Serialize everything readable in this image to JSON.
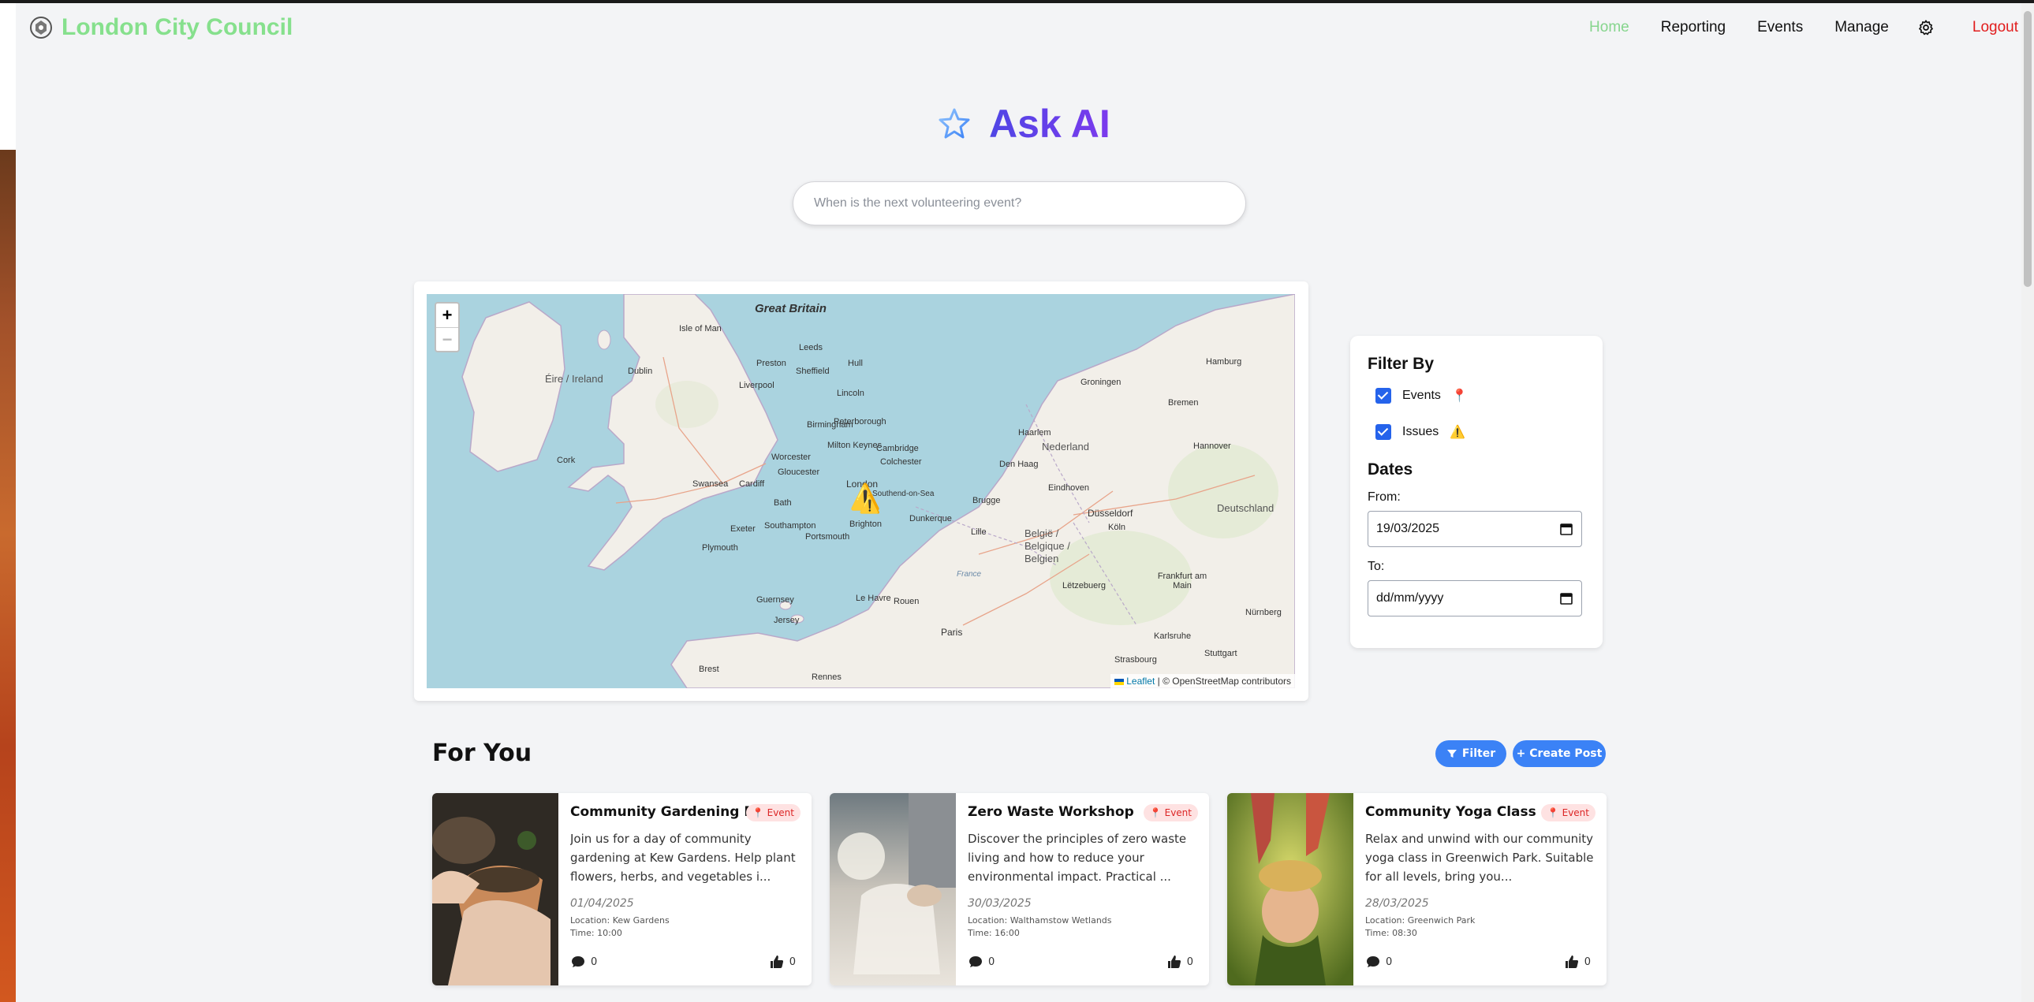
{
  "header": {
    "brand": "London City Council",
    "nav": {
      "home": "Home",
      "reporting": "Reporting",
      "events": "Events",
      "manage": "Manage",
      "logout": "Logout"
    }
  },
  "askai": {
    "title": "Ask AI",
    "placeholder": "When is the next volunteering event?"
  },
  "map": {
    "labels": {
      "great_britain": "Great Britain",
      "ireland": "Éire / Ireland",
      "dublin": "Dublin",
      "cork": "Cork",
      "isle_of_man": "Isle of Man",
      "leeds": "Leeds",
      "sheffield": "Sheffield",
      "hull": "Hull",
      "liverpool": "Liverpool",
      "preston": "Preston",
      "lincoln": "Lincoln",
      "birmingham": "Birmingham",
      "peterborough": "Peterborough",
      "cambridge": "Cambridge",
      "milton_keynes": "Milton Keynes",
      "colchester": "Colchester",
      "worcester": "Worcester",
      "gloucester": "Gloucester",
      "london": "London",
      "swansea": "Swansea",
      "cardiff": "Cardiff",
      "bath": "Bath",
      "southend": "Southend-on-Sea",
      "brighton": "Brighton",
      "southampton": "Southampton",
      "portsmouth": "Portsmouth",
      "exeter": "Exeter",
      "plymouth": "Plymouth",
      "dunkerque": "Dunkerque",
      "lille": "Lille",
      "brugge": "Brugge",
      "belgie": "België / Belgique / Belgien",
      "nederland": "Nederland",
      "den_haag": "Den Haag",
      "haarlem": "Haarlem",
      "eindhoven": "Eindhoven",
      "groningen": "Groningen",
      "bremen": "Bremen",
      "hamburg": "Hamburg",
      "hannover": "Hannover",
      "deutschland": "Deutschland",
      "dusseldorf": "Düsseldorf",
      "koln": "Köln",
      "frankfurt": "Frankfurt am Main",
      "nurnberg": "Nürnberg",
      "letzebuerg": "Lëtzebuerg",
      "paris": "Paris",
      "rouen": "Rouen",
      "le_havre": "Le Havre",
      "rennes": "Rennes",
      "brest": "Brest",
      "guernsey": "Guernsey",
      "jersey": "Jersey",
      "france": "France",
      "karlsruhe": "Karlsruhe",
      "stuttgart": "Stuttgart",
      "strasbourg": "Strasbourg"
    },
    "attribution_leaflet": "Leaflet",
    "attribution_osm": "| © OpenStreetMap contributors"
  },
  "filter": {
    "title": "Filter By",
    "events_label": "Events",
    "issues_label": "Issues",
    "events_checked": true,
    "issues_checked": true,
    "dates_title": "Dates",
    "from_label": "From:",
    "from_value": "19/03/2025",
    "to_label": "To:",
    "to_value": "dd/mm/yyyy"
  },
  "foryou": {
    "title": "For You",
    "filter_button": "Filter",
    "create_button": "+ Create Post",
    "cards": [
      {
        "title": "Community Gardening Day",
        "badge": "Event",
        "desc": "Join us for a day of community gardening at Kew Gardens. Help plant flowers, herbs, and vegetables i...",
        "date": "01/04/2025",
        "location": "Location: Kew Gardens",
        "time": "Time: 10:00",
        "comments": "0",
        "likes": "0"
      },
      {
        "title": "Zero Waste Workshop",
        "badge": "Event",
        "desc": "Discover the principles of zero waste living and how to reduce your environmental impact. Practical ...",
        "date": "30/03/2025",
        "location": "Location: Walthamstow Wetlands",
        "time": "Time: 16:00",
        "comments": "0",
        "likes": "0"
      },
      {
        "title": "Community Yoga Class",
        "badge": "Event",
        "desc": "Relax and unwind with our community yoga class in Greenwich Park. Suitable for all levels, bring you...",
        "date": "28/03/2025",
        "location": "Location: Greenwich Park",
        "time": "Time: 08:30",
        "comments": "0",
        "likes": "0"
      }
    ]
  },
  "colors": {
    "brand": "#86e08d",
    "accent": "#3b82f6",
    "logout": "#e11d1d",
    "badge_bg": "#fee2e2",
    "badge_text": "#dc2626"
  }
}
